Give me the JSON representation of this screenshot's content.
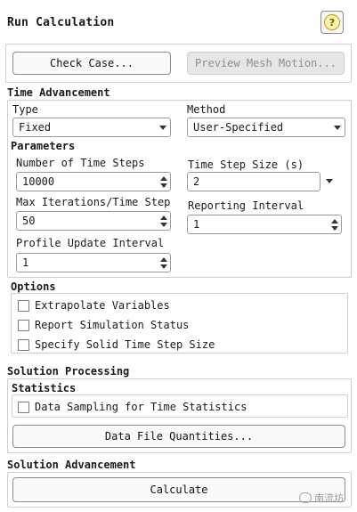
{
  "header": {
    "title": "Run Calculation",
    "help_icon": "question-icon"
  },
  "top_buttons": {
    "check_case": "Check Case...",
    "preview_mesh_motion": "Preview Mesh Motion..."
  },
  "time_advancement": {
    "heading": "Time Advancement",
    "type_label": "Type",
    "type_value": "Fixed",
    "method_label": "Method",
    "method_value": "User-Specified"
  },
  "parameters": {
    "heading": "Parameters",
    "num_time_steps_label": "Number of Time Steps",
    "num_time_steps_value": "10000",
    "time_step_size_label": "Time Step Size (s)",
    "time_step_size_value": "2",
    "max_iter_label": "Max Iterations/Time Step",
    "max_iter_value": "50",
    "reporting_interval_label": "Reporting Interval",
    "reporting_interval_value": "1",
    "profile_update_label": "Profile Update Interval",
    "profile_update_value": "1"
  },
  "options": {
    "heading": "Options",
    "items": [
      {
        "label": "Extrapolate Variables",
        "checked": false
      },
      {
        "label": "Report Simulation Status",
        "checked": false
      },
      {
        "label": "Specify Solid Time Step Size",
        "checked": false
      }
    ]
  },
  "solution_processing": {
    "heading": "Solution Processing",
    "statistics_heading": "Statistics",
    "data_sampling_label": "Data Sampling for Time Statistics",
    "data_file_quantities_button": "Data File Quantities..."
  },
  "solution_advancement": {
    "heading": "Solution Advancement",
    "calculate_button": "Calculate"
  },
  "watermark": {
    "text": "南流坊"
  }
}
